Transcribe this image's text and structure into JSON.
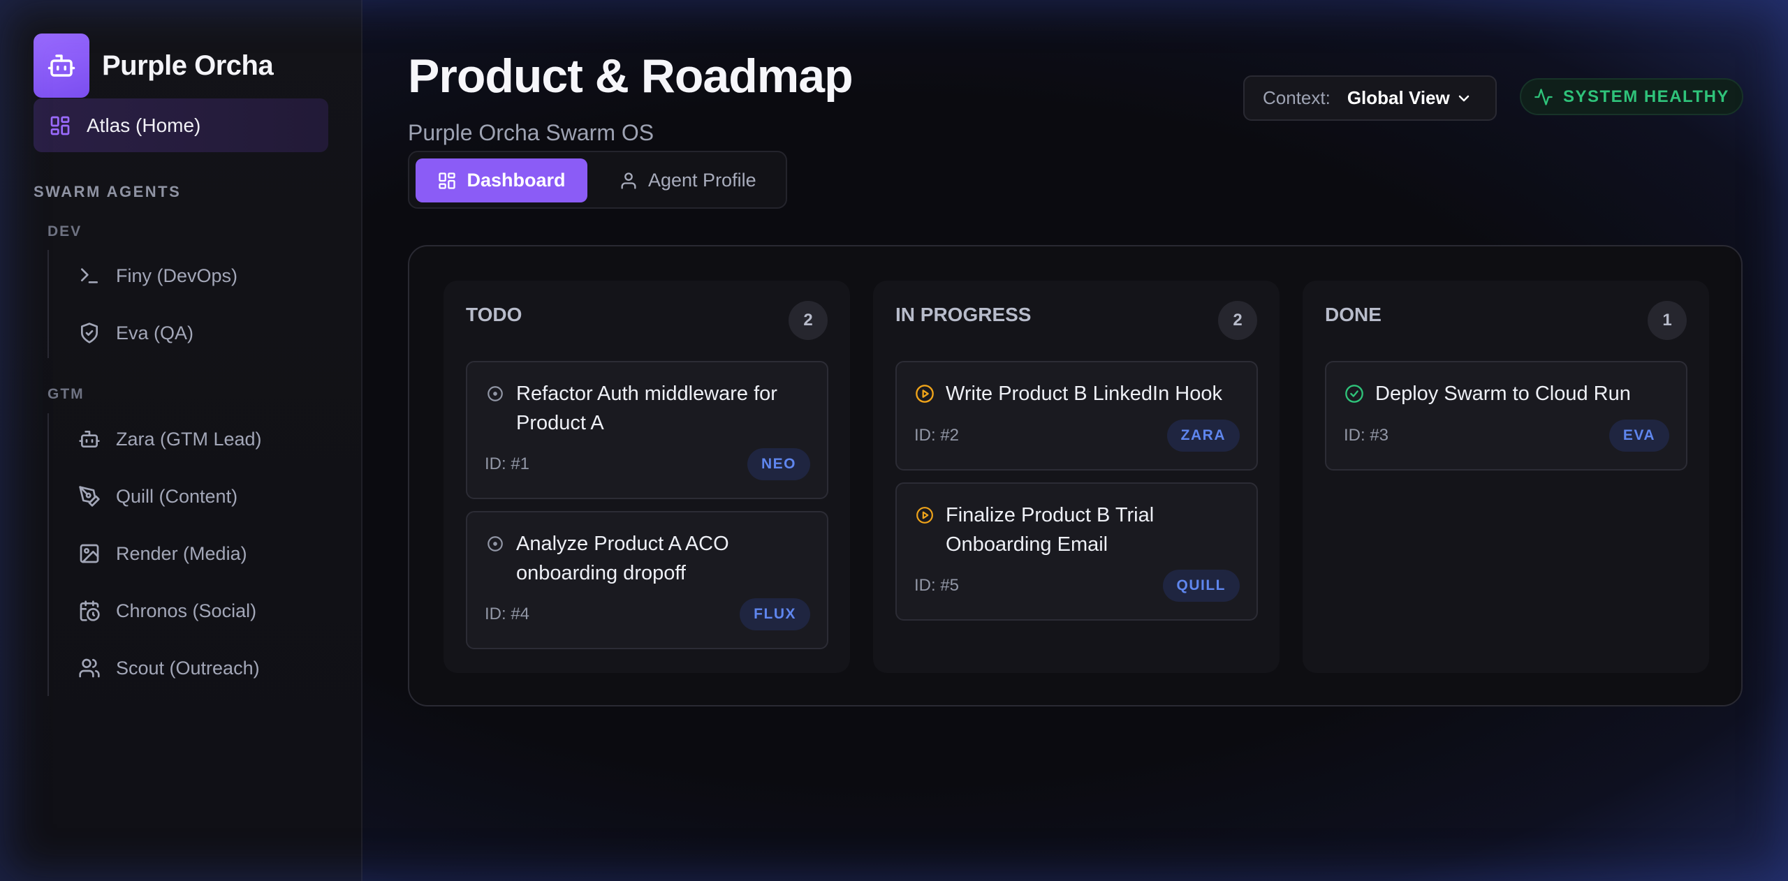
{
  "app": {
    "name": "Purple Orcha"
  },
  "sidebar": {
    "home_label": "Atlas (Home)",
    "section_title": "SWARM AGENTS",
    "groups": [
      {
        "title": "DEV",
        "agents": [
          {
            "label": "Finy (DevOps)",
            "icon": "terminal-icon"
          },
          {
            "label": "Eva (QA)",
            "icon": "shield-icon"
          }
        ]
      },
      {
        "title": "GTM",
        "agents": [
          {
            "label": "Zara (GTM Lead)",
            "icon": "bot-icon"
          },
          {
            "label": "Quill (Content)",
            "icon": "pen-icon"
          },
          {
            "label": "Render (Media)",
            "icon": "image-icon"
          },
          {
            "label": "Chronos (Social)",
            "icon": "calendar-clock-icon"
          },
          {
            "label": "Scout (Outreach)",
            "icon": "users-icon"
          }
        ]
      }
    ]
  },
  "header": {
    "title": "Product & Roadmap",
    "subtitle": "Purple Orcha Swarm OS",
    "tabs": [
      {
        "label": "Dashboard",
        "active": true
      },
      {
        "label": "Agent Profile",
        "active": false
      }
    ],
    "context_label": "Context:",
    "context_value": "Global View",
    "status": "SYSTEM HEALTHY"
  },
  "colors": {
    "accent": "#8b5cf6",
    "healthy": "#2fc37a",
    "in_progress": "#f0a41a",
    "done": "#2fc37a",
    "tag_text": "#5f86ee"
  },
  "board": {
    "columns": [
      {
        "title": "TODO",
        "count": "2",
        "cards": [
          {
            "title": "Refactor Auth middleware for Product A",
            "id": "ID: #1",
            "assignee": "NEO",
            "status": "todo"
          },
          {
            "title": "Analyze Product A ACO onboarding dropoff",
            "id": "ID: #4",
            "assignee": "FLUX",
            "status": "todo"
          }
        ]
      },
      {
        "title": "IN PROGRESS",
        "count": "2",
        "cards": [
          {
            "title": "Write Product B LinkedIn Hook",
            "id": "ID: #2",
            "assignee": "ZARA",
            "status": "in_progress"
          },
          {
            "title": "Finalize Product B Trial Onboarding Email",
            "id": "ID: #5",
            "assignee": "QUILL",
            "status": "in_progress"
          }
        ]
      },
      {
        "title": "DONE",
        "count": "1",
        "cards": [
          {
            "title": "Deploy Swarm to Cloud Run",
            "id": "ID: #3",
            "assignee": "EVA",
            "status": "done"
          }
        ]
      }
    ]
  }
}
